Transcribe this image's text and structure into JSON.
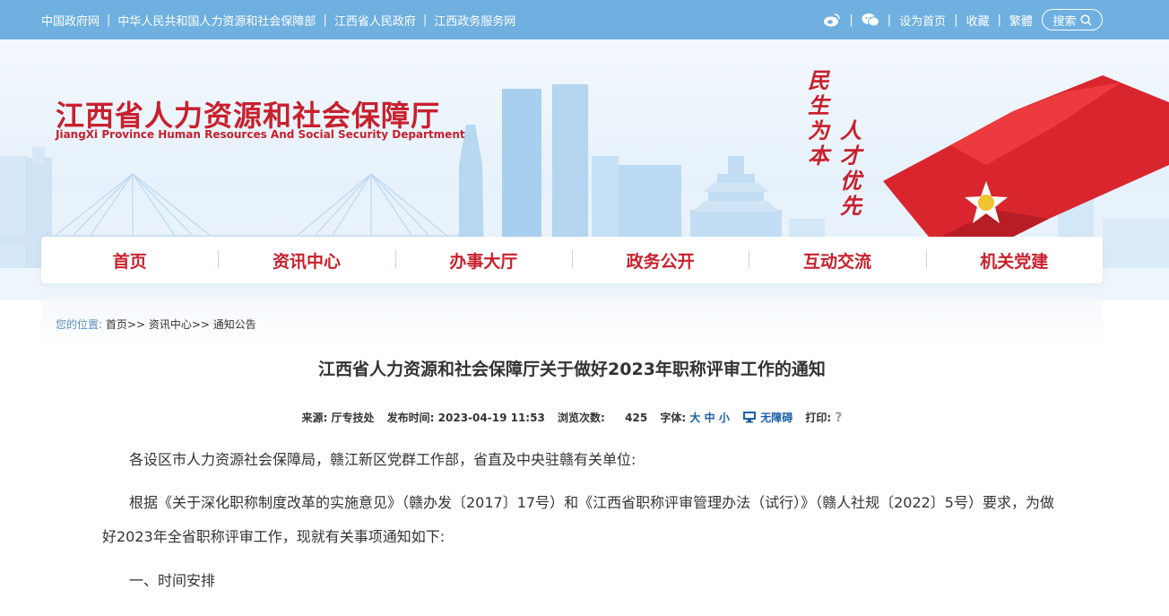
{
  "topbar": {
    "links": [
      "中国政府网",
      "中华人民共和国人力资源和社会保障部",
      "江西省人民政府",
      "江西政务服务网"
    ],
    "weibo_icon": "weibo-icon",
    "wechat_icon": "wechat-icon",
    "set_home": "设为首页",
    "favorite": "收藏",
    "traditional": "繁體",
    "search_label": "搜索"
  },
  "header": {
    "title_cn": "江西省人力资源和社会保障厅",
    "title_en": "JiangXi Province Human Resources And Social Security Department",
    "slogan_left": "民生为本",
    "slogan_right": "人才优先"
  },
  "nav": {
    "items": [
      "首页",
      "资讯中心",
      "办事大厅",
      "政务公开",
      "互动交流",
      "机关党建"
    ]
  },
  "breadcrumb": {
    "lead": "您的位置:",
    "items": [
      "首页",
      "资讯中心",
      "通知公告"
    ],
    "sep": ">>"
  },
  "article": {
    "title": "江西省人力资源和社会保障厅关于做好2023年职称评审工作的通知",
    "meta": {
      "source_label": "来源:",
      "source": "厅专技处",
      "time_label": "发布时间:",
      "time": "2023-04-19 11:53",
      "views_label": "浏览次数:",
      "views": "425",
      "font_label": "字体:",
      "font_large": "大",
      "font_medium": "中",
      "font_small": "小",
      "accessibility": "无障碍",
      "print_label": "打印:",
      "print_icon": "?"
    },
    "paragraphs": [
      "各设区市人力资源社会保障局，赣江新区党群工作部，省直及中央驻赣有关单位:",
      "根据《关于深化职称制度改革的实施意见》（赣办发〔2017〕17号）和《江西省职称评审管理办法（试行）》（赣人社规〔2022〕5号）要求，为做好2023年全省职称评审工作，现就有关事项通知如下:",
      "一、时间安排"
    ]
  },
  "colors": {
    "topbar": "#6fb0e0",
    "brand_red": "#c8202d",
    "link_blue": "#1b5fa8"
  }
}
